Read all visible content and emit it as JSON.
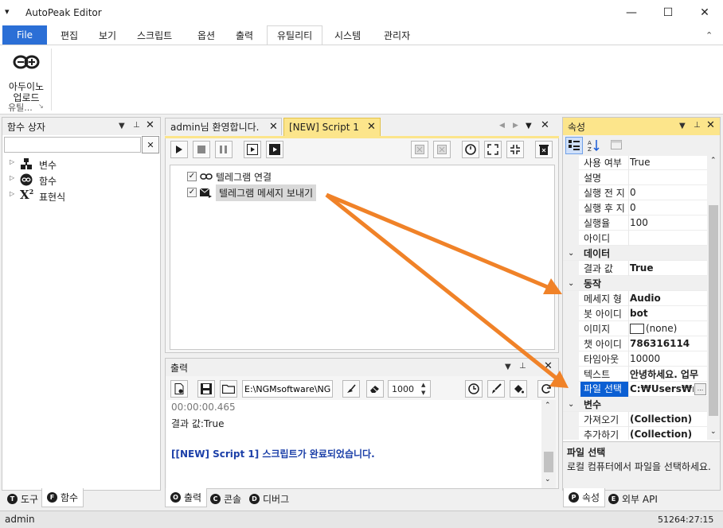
{
  "window": {
    "title": "AutoPeak Editor",
    "minimize": "—",
    "maximize": "☐",
    "close": "✕",
    "menu_glyph": "▾"
  },
  "ribbon": {
    "tabs": [
      "File",
      "편집",
      "보기",
      "스크립트",
      "옵션",
      "출력",
      "유틸리티",
      "시스템",
      "관리자"
    ],
    "active": "유틸리티",
    "collapse": "⌃",
    "arduino_label1": "아두이노",
    "arduino_label2": "업로드",
    "group_label": "유틸...",
    "group_launcher": "↘"
  },
  "func_panel": {
    "title": "함수 상자",
    "search_value": "",
    "clear": "✕",
    "items": [
      {
        "icon": "variable-icon",
        "label": "변수"
      },
      {
        "icon": "function-icon",
        "label": "함수"
      },
      {
        "icon": "expression-icon",
        "label": "표현식"
      }
    ],
    "bottom_tabs": [
      {
        "badge": "T",
        "label": "도구"
      },
      {
        "badge": "F",
        "label": "함수"
      }
    ]
  },
  "doc": {
    "tabs": [
      {
        "label": "admin님 환영합니다.",
        "close": "✕"
      },
      {
        "label": "[NEW] Script 1",
        "close": "✕"
      }
    ],
    "script_items": [
      {
        "label": "텔레그램 연결",
        "checked": true
      },
      {
        "label": "텔레그램 메세지 보내기",
        "checked": true
      }
    ]
  },
  "output": {
    "title": "출력",
    "path": "E:\\NGMsoftware\\NG",
    "count": "1000",
    "lines": [
      {
        "text": "00:00:00.465",
        "color": "#777"
      },
      {
        "text": "결과 값:True",
        "color": "#1e1e1e"
      },
      {
        "text": "",
        "color": "#1e1e1e"
      },
      {
        "text": "[[NEW] Script 1] 스크립트가 완료되었습니다.",
        "color": "#1b3fa8"
      }
    ],
    "bottom_tabs": [
      {
        "badge": "O",
        "label": "출력"
      },
      {
        "badge": "C",
        "label": "콘솔"
      },
      {
        "badge": "D",
        "label": "디버그"
      }
    ]
  },
  "props": {
    "title": "속성",
    "rows": [
      {
        "type": "prop",
        "key": "사용 여부",
        "value": "True",
        "bold": false
      },
      {
        "type": "prop",
        "key": "설명",
        "value": "",
        "bold": false
      },
      {
        "type": "prop",
        "key": "실행 전 지",
        "value": "0",
        "bold": false
      },
      {
        "type": "prop",
        "key": "실행 후 지",
        "value": "0",
        "bold": false
      },
      {
        "type": "prop",
        "key": "실행율",
        "value": "100",
        "bold": false
      },
      {
        "type": "prop",
        "key": "아이디",
        "value": "",
        "bold": false
      },
      {
        "type": "cat",
        "key": "데이터"
      },
      {
        "type": "prop",
        "key": "결과 값",
        "value": "True",
        "bold": true
      },
      {
        "type": "cat",
        "key": "동작"
      },
      {
        "type": "prop",
        "key": "메세지 형",
        "value": "Audio",
        "bold": true
      },
      {
        "type": "prop",
        "key": "봇 아이디",
        "value": "bot",
        "bold": true
      },
      {
        "type": "img",
        "key": "이미지",
        "value": "(none)",
        "bold": false
      },
      {
        "type": "prop",
        "key": "챗 아이디",
        "value": "786316114",
        "bold": true
      },
      {
        "type": "prop",
        "key": "타임아웃",
        "value": "10000",
        "bold": false
      },
      {
        "type": "prop",
        "key": "텍스트",
        "value": "안녕하세요. 업무",
        "bold": true
      },
      {
        "type": "sel",
        "key": "파일 선택",
        "value": "C:₩Users₩ngm",
        "bold": true
      },
      {
        "type": "cat",
        "key": "변수"
      },
      {
        "type": "prop",
        "key": "가져오기",
        "value": "(Collection)",
        "bold": true
      },
      {
        "type": "prop",
        "key": "추가하기",
        "value": "(Collection)",
        "bold": true
      }
    ],
    "desc_title": "파일 선택",
    "desc_text": "로컬 컴퓨터에서 파일을 선택하세요.",
    "bottom_tabs": [
      {
        "badge": "P",
        "label": "속성"
      },
      {
        "badge": "E",
        "label": "외부 API"
      }
    ]
  },
  "status": {
    "left": "admin",
    "right": "51264:27:15"
  },
  "colors": {
    "accent": "#2b6fd6",
    "arrow": "#f08228",
    "active_tab": "#fce58b",
    "selected_row": "#0b5fd3"
  }
}
